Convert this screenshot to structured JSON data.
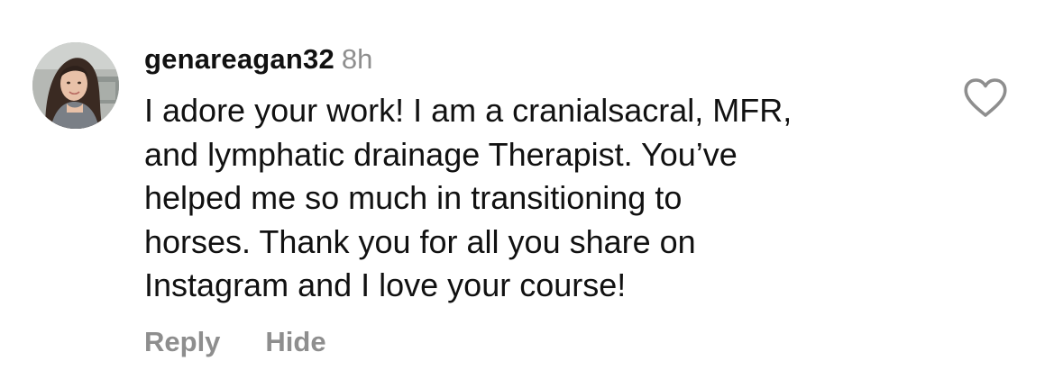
{
  "comment": {
    "username": "genareagan32",
    "timestamp": "8h",
    "text": "I adore your work! I am a cranialsacral, MFR,\nand lymphatic drainage Therapist. You’ve\nhelped me so much in transitioning to\nhorses. Thank you for all you share on\nInstagram and I love your course!",
    "avatar_icon": "user-avatar-photo",
    "like_icon": "heart-outline-icon",
    "actions": {
      "reply_label": "Reply",
      "hide_label": "Hide"
    }
  },
  "colors": {
    "text": "#111111",
    "muted": "#8e8e8e",
    "background": "#ffffff"
  }
}
